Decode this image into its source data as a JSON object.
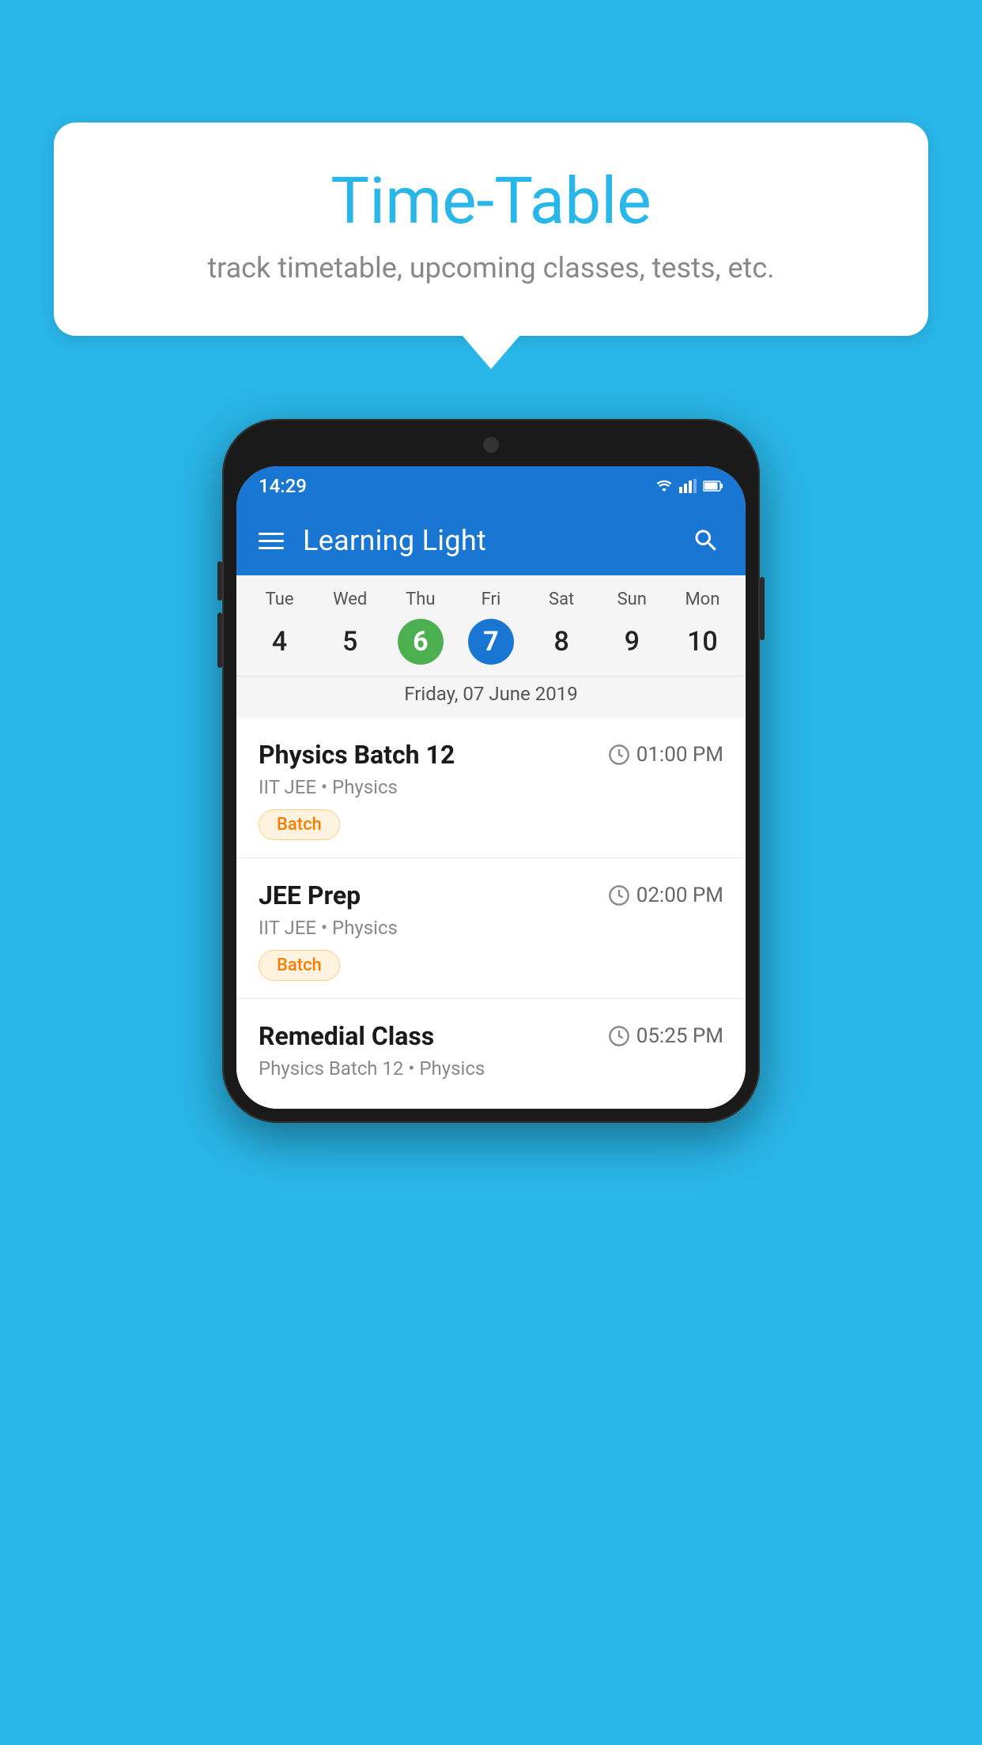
{
  "background_color": "#29B6E8",
  "tooltip": {
    "title": "Time-Table",
    "subtitle": "track timetable, upcoming classes, tests, etc."
  },
  "phone": {
    "status_bar": {
      "time": "14:29",
      "icons": [
        "wifi",
        "signal",
        "battery"
      ]
    },
    "app_bar": {
      "title": "Learning Light"
    },
    "calendar": {
      "days": [
        "Tue",
        "Wed",
        "Thu",
        "Fri",
        "Sat",
        "Sun",
        "Mon"
      ],
      "dates": [
        "4",
        "5",
        "6",
        "7",
        "8",
        "9",
        "10"
      ],
      "today_index": 2,
      "selected_index": 3,
      "selected_date_label": "Friday, 07 June 2019"
    },
    "schedule": [
      {
        "title": "Physics Batch 12",
        "time": "01:00 PM",
        "subtitle": "IIT JEE • Physics",
        "tag": "Batch"
      },
      {
        "title": "JEE Prep",
        "time": "02:00 PM",
        "subtitle": "IIT JEE • Physics",
        "tag": "Batch"
      },
      {
        "title": "Remedial Class",
        "time": "05:25 PM",
        "subtitle": "Physics Batch 12 • Physics",
        "tag": null
      }
    ]
  }
}
